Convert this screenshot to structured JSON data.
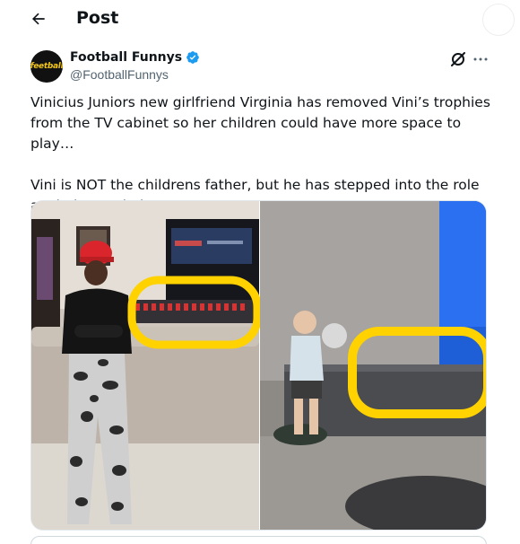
{
  "header": {
    "title": "Post",
    "back_icon": "arrow-left-icon"
  },
  "author": {
    "display_name": "Football Funnys",
    "handle": "@FootballFunnys",
    "avatar_text": "feetball",
    "verified": true,
    "verified_color": "#1d9bf0"
  },
  "tweet": {
    "paragraph1": "Vinicius Juniors new girlfriend Virginia has removed Vini’s trophies from the TV cabinet so her children could have more space to play…",
    "paragraph2": "Vini is NOT the childrens father, but he has stepped into the role as their stepdad…"
  },
  "media": {
    "highlight_color": "#ffd200",
    "icons": [
      "grok-icon",
      "more-icon"
    ]
  }
}
